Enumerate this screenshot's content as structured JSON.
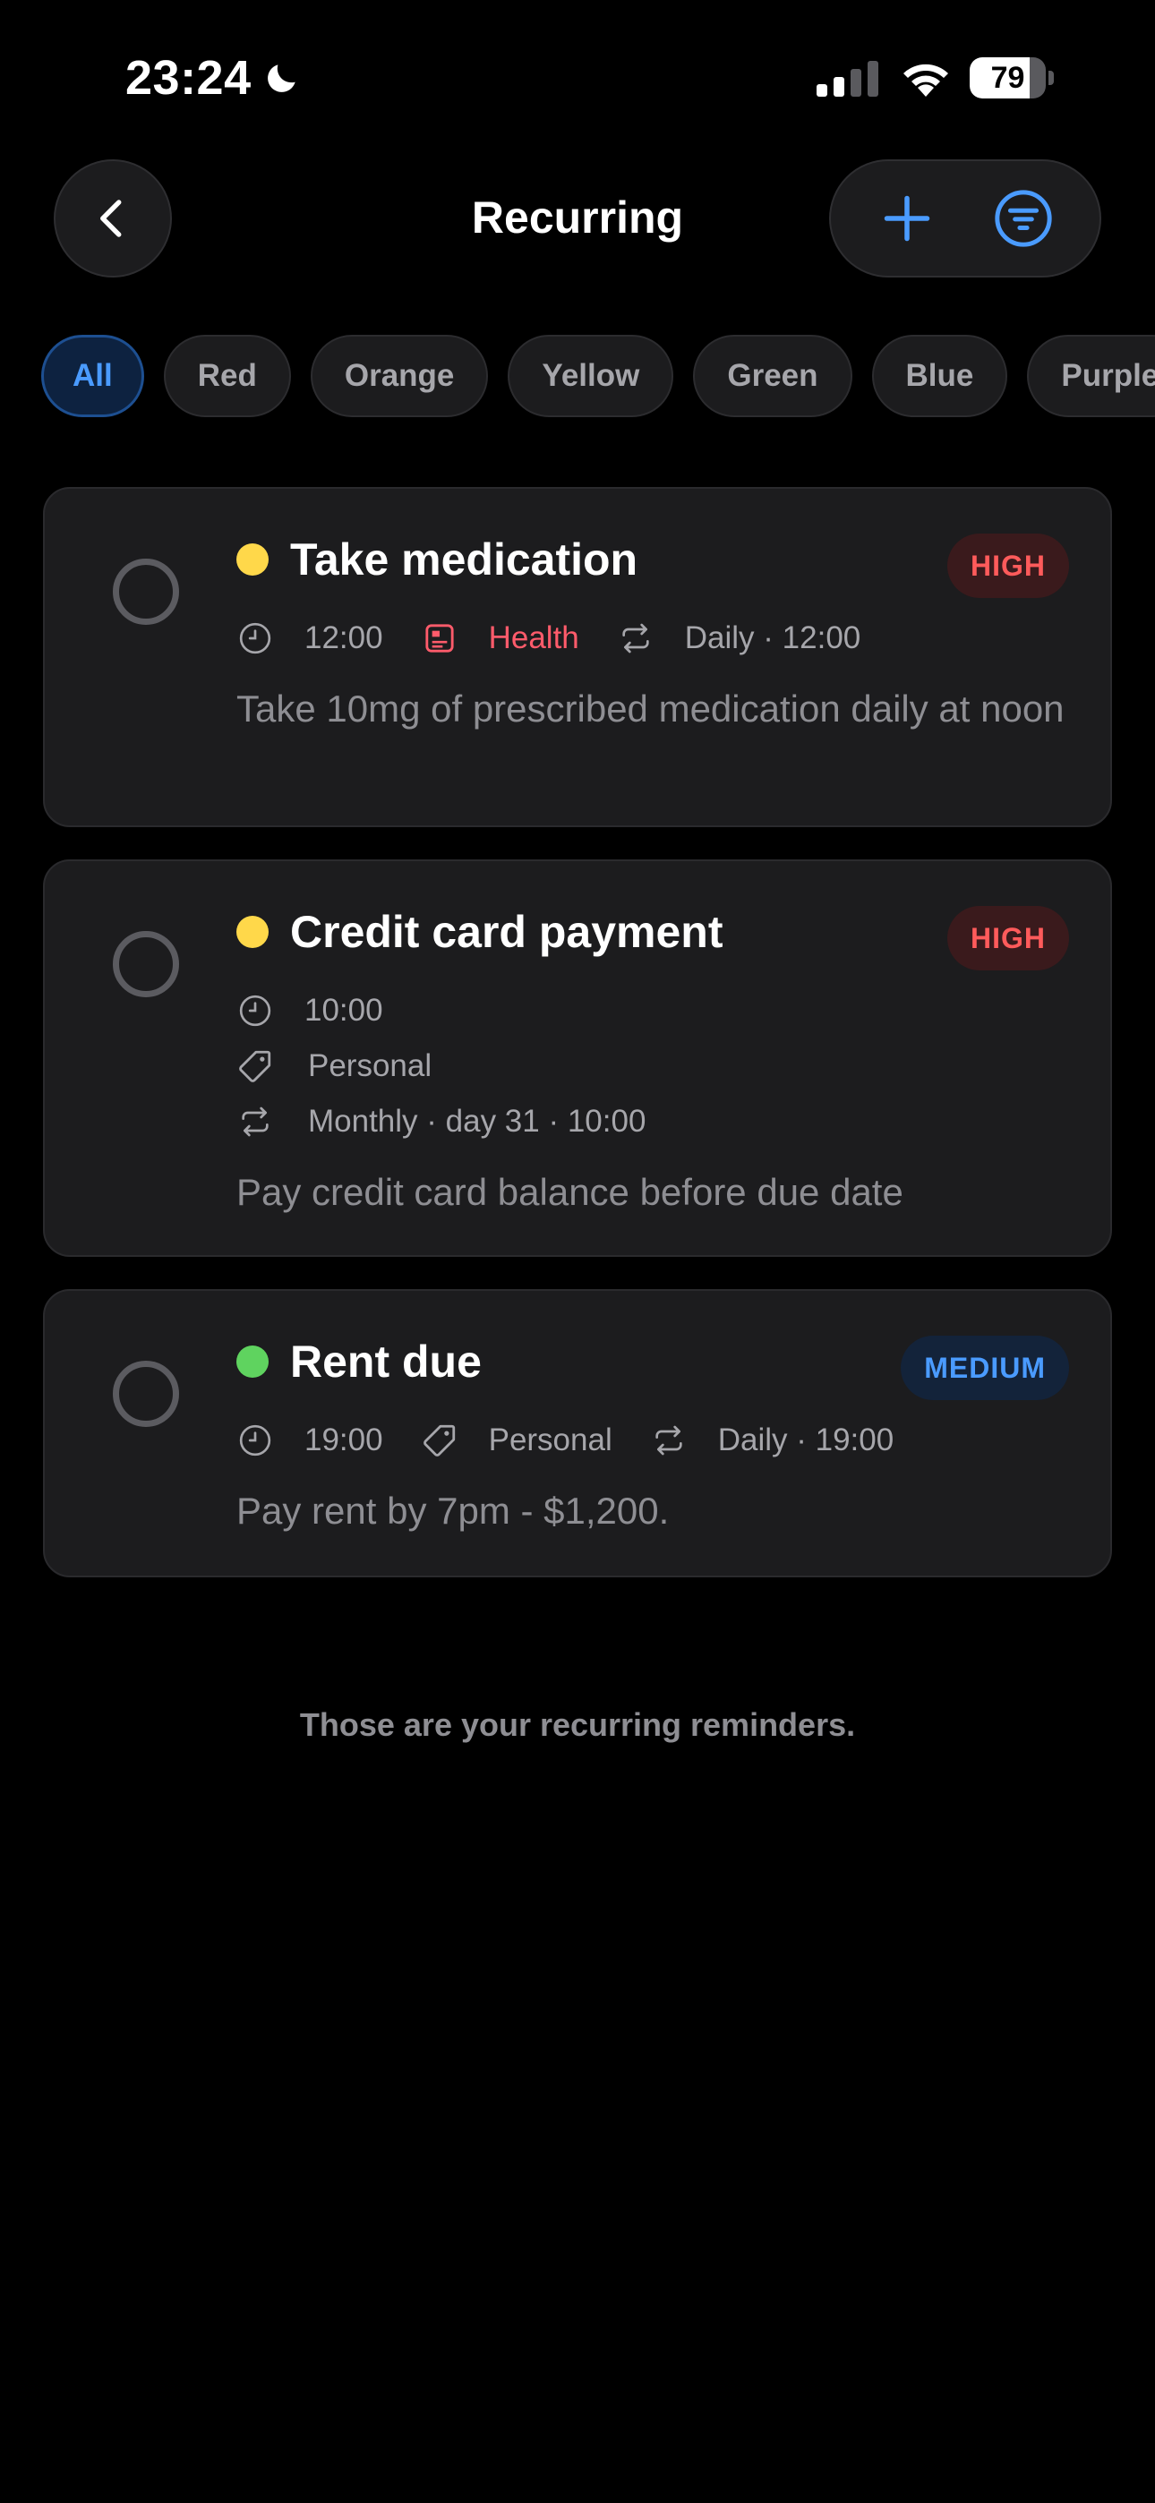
{
  "status_bar": {
    "time": "23:24",
    "battery_level": "79",
    "battery_fraction": 0.79
  },
  "nav": {
    "title": "Recurring",
    "back_icon": "chevron-left-icon",
    "add_icon": "plus-icon",
    "filter_icon": "filter-icon"
  },
  "filters": {
    "chips": [
      "All",
      "Red",
      "Orange",
      "Yellow",
      "Green",
      "Blue",
      "Purple"
    ],
    "selected": "All"
  },
  "colors": {
    "accent": "#4a9bff",
    "health": "#ff5b6b",
    "dot_yellow": "#ffd84a",
    "dot_green": "#5fd35f",
    "high_badge_bg": "#3a1a1c",
    "high_badge_text": "#ff5b5b",
    "medium_badge_bg": "#13233a",
    "medium_badge_text": "#4a9bff"
  },
  "reminders": [
    {
      "title": "Take medication",
      "priority": "HIGH",
      "time": "12:00",
      "category": "Health",
      "category_icon": "health-icon",
      "repeat": "Daily · 12:00",
      "description": "Take 10mg of prescribed medication daily at noon"
    },
    {
      "title": "Credit card payment",
      "priority": "HIGH",
      "time": "10:00",
      "category": "Personal",
      "category_icon": "tag-icon",
      "repeat": "Monthly · day 31 · 10:00",
      "description": "Pay credit card balance before due date"
    },
    {
      "title": "Rent due",
      "priority": "MEDIUM",
      "time": "19:00",
      "category": "Personal",
      "category_icon": "tag-icon",
      "repeat": "Daily · 19:00",
      "description": "Pay rent by 7pm - $1,200."
    }
  ],
  "footer": {
    "note": "Those are your recurring reminders."
  }
}
